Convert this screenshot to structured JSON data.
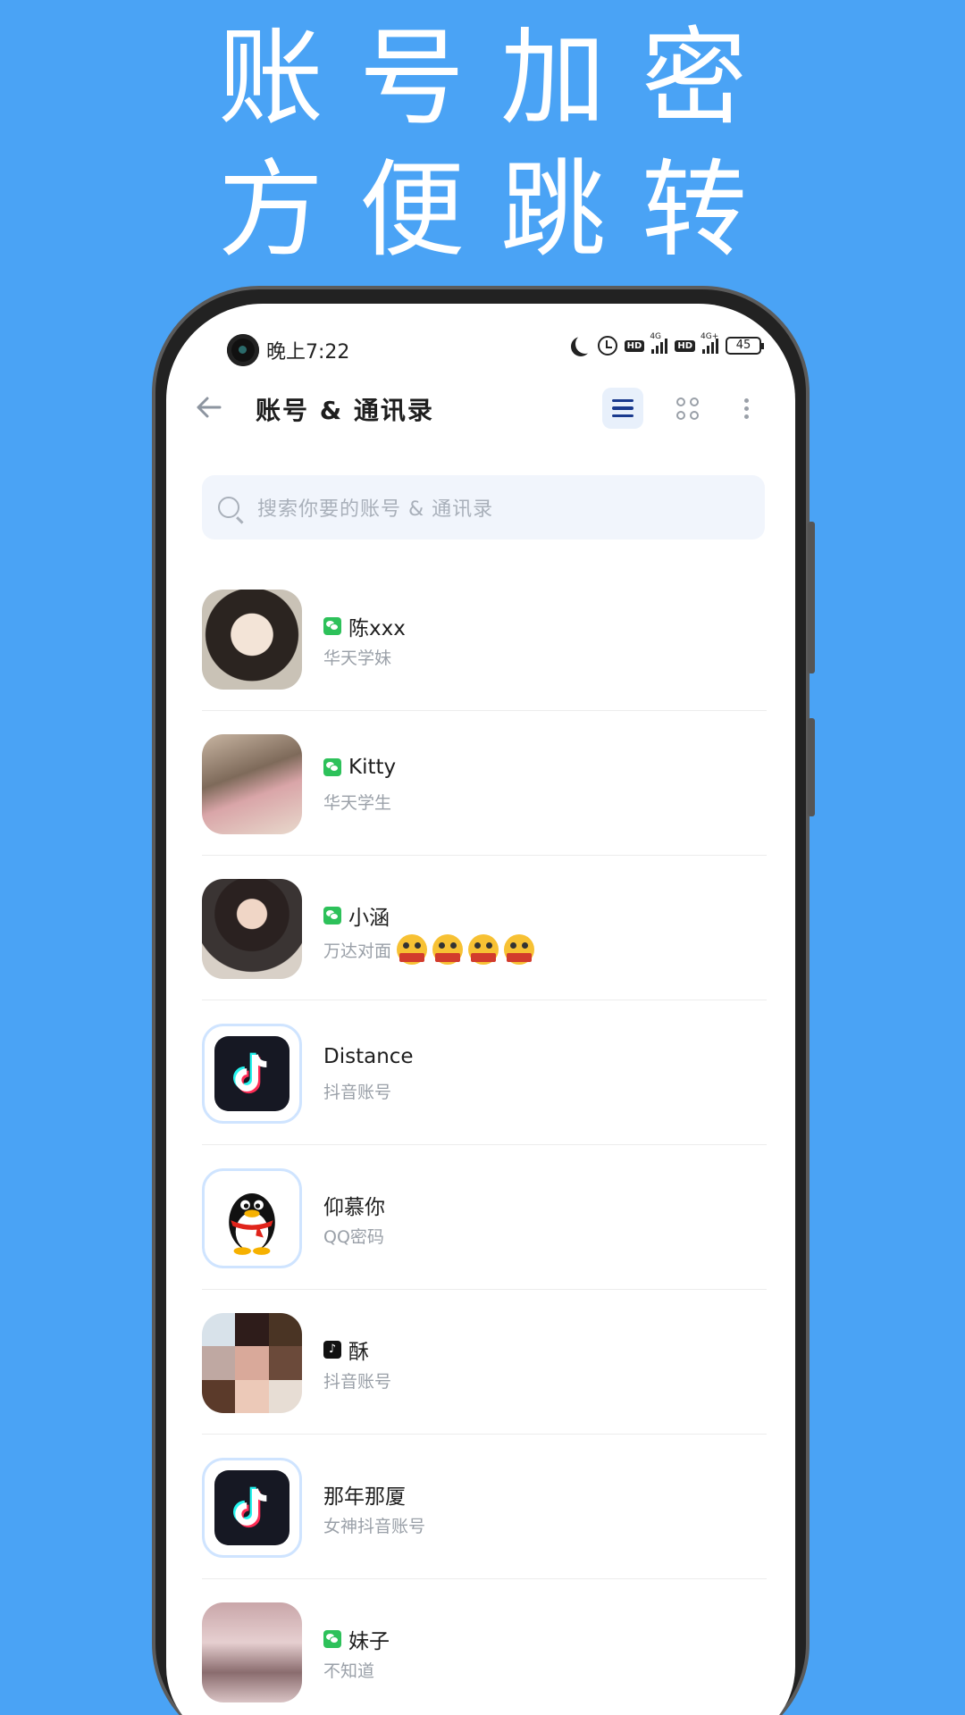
{
  "headline": {
    "line1": "账号加密",
    "line2": "方便跳转"
  },
  "status_bar": {
    "time": "晚上7:22",
    "network1": "4G",
    "network2": "4G+",
    "battery": "45",
    "hd1": "HD",
    "hd2": "HD"
  },
  "toolbar": {
    "title": "账号 & 通讯录"
  },
  "search": {
    "placeholder": "搜索你要的账号 & 通讯录"
  },
  "contacts": [
    {
      "name": "陈xxx",
      "subtitle": "华天学妹",
      "platform": "wechat"
    },
    {
      "name": "Kitty",
      "subtitle": "华天学生",
      "platform": "wechat"
    },
    {
      "name": "小涵",
      "subtitle": "万达对面",
      "platform": "wechat",
      "emoji_count": 4
    },
    {
      "name": "Distance",
      "subtitle": "抖音账号",
      "platform": "none"
    },
    {
      "name": "仰慕你",
      "subtitle": "QQ密码",
      "platform": "none"
    },
    {
      "name": "酥",
      "subtitle": "抖音账号",
      "platform": "douyin"
    },
    {
      "name": "那年那厦",
      "subtitle": "女神抖音账号",
      "platform": "none"
    },
    {
      "name": "妹子",
      "subtitle": "不知道",
      "platform": "wechat"
    }
  ],
  "colors": {
    "background": "#4aa3f5",
    "accent": "#1a3a8e",
    "wechat": "#2dc15a"
  }
}
